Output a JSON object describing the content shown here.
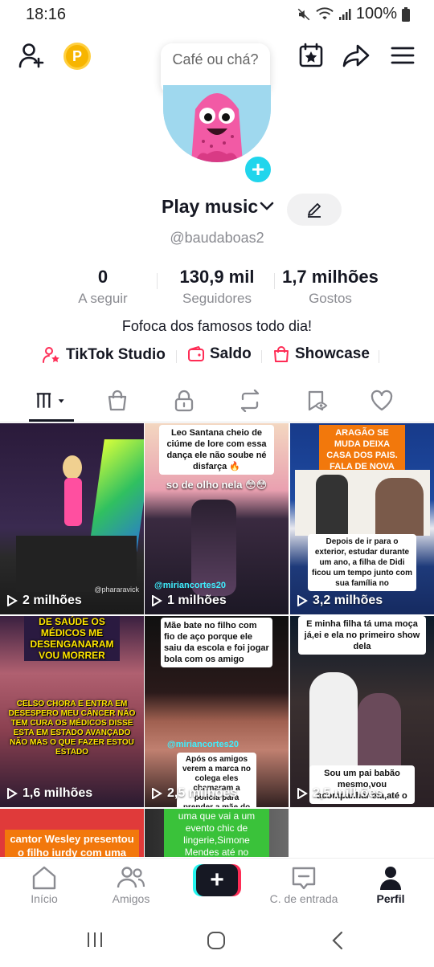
{
  "status_bar": {
    "time": "18:16",
    "battery": "100%"
  },
  "bubble": {
    "text": "Café ou chá?"
  },
  "profile": {
    "display_name": "Play music",
    "handle": "@baudaboas2",
    "bio": "Fofoca dos famosos todo dia!"
  },
  "stats": [
    {
      "value": "0",
      "label": "A seguir"
    },
    {
      "value": "130,9 mil",
      "label": "Seguidores"
    },
    {
      "value": "1,7 milhões",
      "label": "Gostos"
    }
  ],
  "links": [
    {
      "label": "TikTok Studio",
      "icon": "person-star-icon"
    },
    {
      "label": "Saldo",
      "icon": "wallet-icon"
    },
    {
      "label": "Showcase",
      "icon": "shopping-bag-icon"
    }
  ],
  "videos": [
    {
      "views": "2 milhões",
      "caption": "",
      "watermark": "@phararavick"
    },
    {
      "views": "1 milhões",
      "caption": "Leo Santana cheio de ciúme de lore com essa dança ele não soube né disfarça 🔥",
      "caption2": "so de olho nela 😳😳",
      "watermark": "@miriancortes20"
    },
    {
      "views": "3,2 milhões",
      "caption": "ARAGÃO SE MUDA DEIXA CASA DOS PAIS. FALA DE NOVA RELAÇÃO E O QUE DIDI PENSA A GENTE SABE",
      "caption2": "Depois de ir para o exterior, estudar durante um ano, a filha de Didi ficou um tempo junto com sua família no"
    },
    {
      "views": "1,6 milhões",
      "caption": "DE SAÚDE OS MÉDICOS ME DESENGANARAM VOU MORRER",
      "caption2": "CELSO CHORA E ENTRA EM DESESPERO MEU CÂNCER NÃO TEM CURA OS MÉDICOS DISSE ESTA EM ESTADO AVANÇADO NÃO MAS O QUE FAZER ESTOU ESTADO"
    },
    {
      "views": "2,5 milhões",
      "caption": "Mãe bate no filho com fio de aço porque ele saiu da escola e foi jogar bola com os amigo",
      "caption2": "Após os amigos verem a marca no colega eles chamaram a polícia para prender a mãe do",
      "watermark": "@miriancortes20"
    },
    {
      "views": "2,5 milhões",
      "caption": "E minha filha tá uma moça já,ei e ela no primeiro show dela",
      "caption2": "Sou um pai babão mesmo,vou acompanhar ela,até o"
    },
    {
      "views": "",
      "caption": "cantor Wesley presentou o filho iurdy com uma Ferrari e"
    },
    {
      "views": "",
      "caption": "uma que vai a um evento chic de lingerie,Simone Mendes até no"
    }
  ],
  "bottom_nav": [
    {
      "label": "Início",
      "icon": "home-icon"
    },
    {
      "label": "Amigos",
      "icon": "friends-icon"
    },
    {
      "label": "",
      "icon": "create-icon"
    },
    {
      "label": "C. de entrada",
      "icon": "inbox-icon"
    },
    {
      "label": "Perfil",
      "icon": "profile-icon"
    }
  ],
  "colors": {
    "accent_cyan": "#20d5ec",
    "accent_red": "#fe2c55",
    "coin": "#f7b500"
  }
}
